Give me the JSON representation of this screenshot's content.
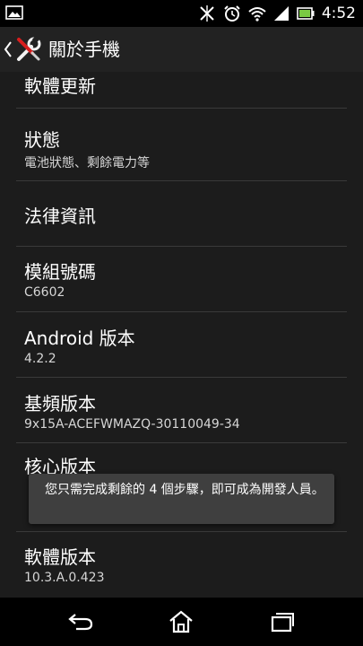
{
  "status_bar": {
    "time": "4:52",
    "icons": [
      "image-notification-icon",
      "signal-off-icon",
      "alarm-icon",
      "wifi-icon",
      "cellular-signal-icon",
      "battery-icon"
    ]
  },
  "action_bar": {
    "title": "關於手機",
    "back_icon": "chevron-left-icon",
    "app_icon": "settings-tools-icon"
  },
  "settings": [
    {
      "title": "軟體更新",
      "subtitle": ""
    },
    {
      "title": "狀態",
      "subtitle": "電池狀態、剩餘電力等"
    },
    {
      "title": "法律資訊",
      "subtitle": ""
    },
    {
      "title": "模組號碼",
      "subtitle": "C6602"
    },
    {
      "title": "Android 版本",
      "subtitle": "4.2.2"
    },
    {
      "title": "基頻版本",
      "subtitle": "9x15A-ACEFWMAZQ-30110049-34"
    },
    {
      "title": "核心版本",
      "subtitle": ""
    },
    {
      "title": "軟體版本",
      "subtitle": "10.3.A.0.423"
    }
  ],
  "toast": {
    "message": "您只需完成剩餘的 4 個步驟，即可成為開發人員。"
  },
  "nav_bar": {
    "icons": [
      "back-icon",
      "home-icon",
      "recent-apps-icon"
    ]
  },
  "colors": {
    "background": "#1c1c1c",
    "divider": "#3a3a3a",
    "toast": "#3f3f3f",
    "battery": "#7ac943"
  }
}
